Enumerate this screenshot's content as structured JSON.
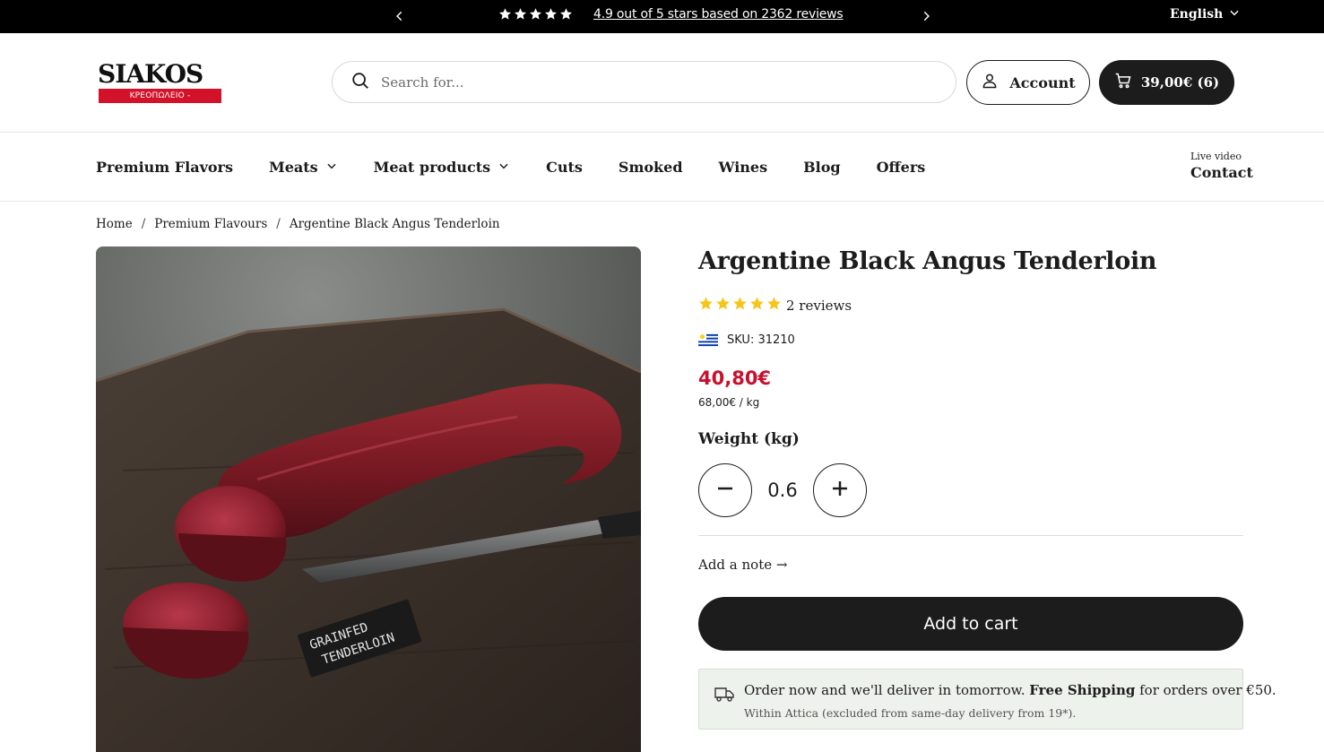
{
  "announcement": {
    "stars": 5,
    "rating_text": "4.9 out of 5 stars based on 2362 reviews",
    "language": "English"
  },
  "header": {
    "logo_wordmark": "SIAKOS",
    "logo_tagline": "ΚΡΕΟΠΩΛΕΙΟ - ΠΑΝΤΟΠΩΛΕΙΟ",
    "search_placeholder": "Search for...",
    "account_label": "Account",
    "cart_label": "39,00€ (6)"
  },
  "nav": {
    "items": [
      {
        "label": "Premium Flavors",
        "dropdown": false
      },
      {
        "label": "Meats",
        "dropdown": true
      },
      {
        "label": "Meat products",
        "dropdown": true
      },
      {
        "label": "Cuts",
        "dropdown": false
      },
      {
        "label": "Smoked",
        "dropdown": false
      },
      {
        "label": "Wines",
        "dropdown": false
      },
      {
        "label": "Blog",
        "dropdown": false
      },
      {
        "label": "Offers",
        "dropdown": false
      }
    ],
    "contact_small": "Live video",
    "contact_label": "Contact"
  },
  "breadcrumb": {
    "items": [
      "Home",
      "Premium Flavours",
      "Argentine Black Angus Tenderloin"
    ],
    "separator": "/"
  },
  "product": {
    "image_label": "GRAINFED TENDERLOIN",
    "title": "Argentine Black Angus Tenderloin",
    "stars": 5,
    "reviews_text": "2 reviews",
    "sku": "SKU: 31210",
    "price": "40,80€",
    "unit_price": "68,00€ / kg",
    "weight_label": "Weight (kg)",
    "quantity": "0.6",
    "note_label": "Add a note →",
    "add_to_cart": "Add to cart",
    "delivery_text_1": "Order now and we'll deliver in tomorrow. ",
    "delivery_bold": "Free Shipping",
    "delivery_text_2": " for orders over €50.",
    "delivery_sub": "Within Attica (excluded from same-day delivery from 19*)."
  },
  "colors": {
    "topbar_bg": "#000000",
    "price_red": "#c8102e",
    "brand_red": "#d3122a",
    "star_gold": "#f5c518",
    "button_dark": "#1c1c1c",
    "delivery_bg": "#eef2ec"
  },
  "icons": [
    "chevron-left-icon",
    "chevron-right-icon",
    "star-icon",
    "chevron-down-icon",
    "search-icon",
    "user-icon",
    "cart-icon",
    "minus-icon",
    "plus-icon",
    "delivery-truck-icon",
    "uruguay-flag-icon"
  ]
}
